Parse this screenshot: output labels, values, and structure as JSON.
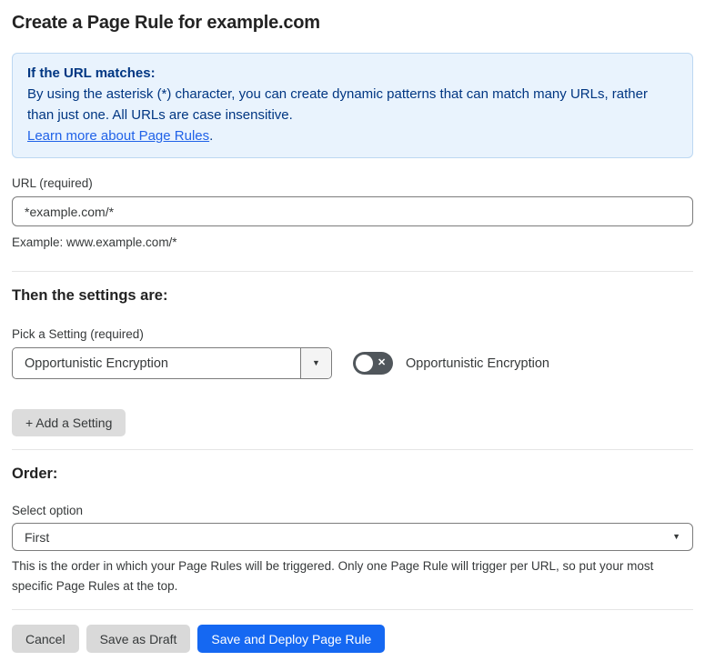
{
  "page": {
    "title": "Create a Page Rule for example.com"
  },
  "info_box": {
    "heading": "If the URL matches:",
    "body": "By using the asterisk (*) character, you can create dynamic patterns that can match many URLs, rather than just one. All URLs are case insensitive.",
    "link_label": "Learn more about Page Rules",
    "link_suffix": "."
  },
  "url_field": {
    "label": "URL (required)",
    "value": "*example.com/*",
    "helper": "Example: www.example.com/*"
  },
  "settings_section": {
    "heading": "Then the settings are:",
    "pick_label": "Pick a Setting (required)",
    "selected_setting": "Opportunistic Encryption",
    "toggle_label": "Opportunistic Encryption",
    "toggle_state": "off",
    "add_button_label": "+ Add a Setting"
  },
  "order_section": {
    "heading": "Order:",
    "select_label": "Select option",
    "selected_option": "First",
    "helper": "This is the order in which your Page Rules will be triggered. Only one Page Rule will trigger per URL, so put your most specific Page Rules at the top."
  },
  "footer": {
    "cancel_label": "Cancel",
    "save_draft_label": "Save as Draft",
    "save_deploy_label": "Save and Deploy Page Rule"
  },
  "icons": {
    "dropdown_arrow": "▼",
    "toggle_x": "✕"
  },
  "colors": {
    "accent_blue": "#1568F2",
    "info_bg": "#E9F3FD",
    "info_border": "#BDD8F2",
    "info_text": "#003682",
    "link_blue": "#2062E8",
    "toggle_off_bg": "#50565B",
    "button_gray": "#D9D9D9"
  }
}
